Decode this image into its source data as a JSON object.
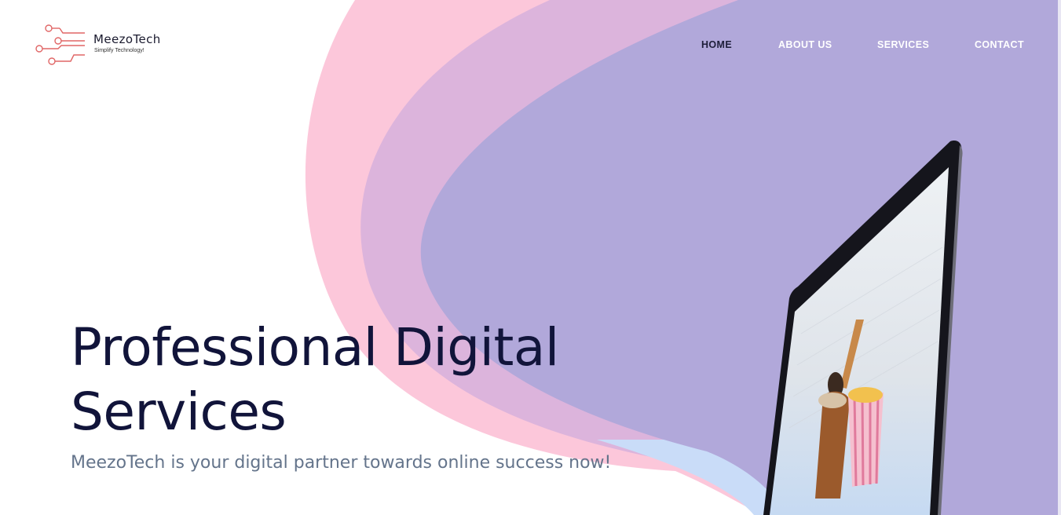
{
  "brand": {
    "name": "MeezoTech",
    "tagline": "Simplify Technology!",
    "logo_icon": "circuit-icon",
    "logo_color": "#e06666"
  },
  "nav": {
    "items": [
      {
        "label": "HOME",
        "active": true
      },
      {
        "label": "ABOUT US",
        "active": false
      },
      {
        "label": "SERVICES",
        "active": false
      },
      {
        "label": "CONTACT",
        "active": false
      }
    ]
  },
  "hero": {
    "title_line1": "Professional Digital",
    "title_line2": "Services",
    "subtitle": "MeezoTech is your digital partner towards online success now!"
  },
  "colors": {
    "background": "#ffffff",
    "wave_pink": "#fcc7da",
    "wave_mauve": "#dcb4dc",
    "wave_lavender": "#b1a8da",
    "wave_blue": "#c9dcf8",
    "title": "#11143a",
    "subtitle": "#64748b",
    "nav_active": "#1e1e3a",
    "nav_inactive": "#ffffff"
  }
}
